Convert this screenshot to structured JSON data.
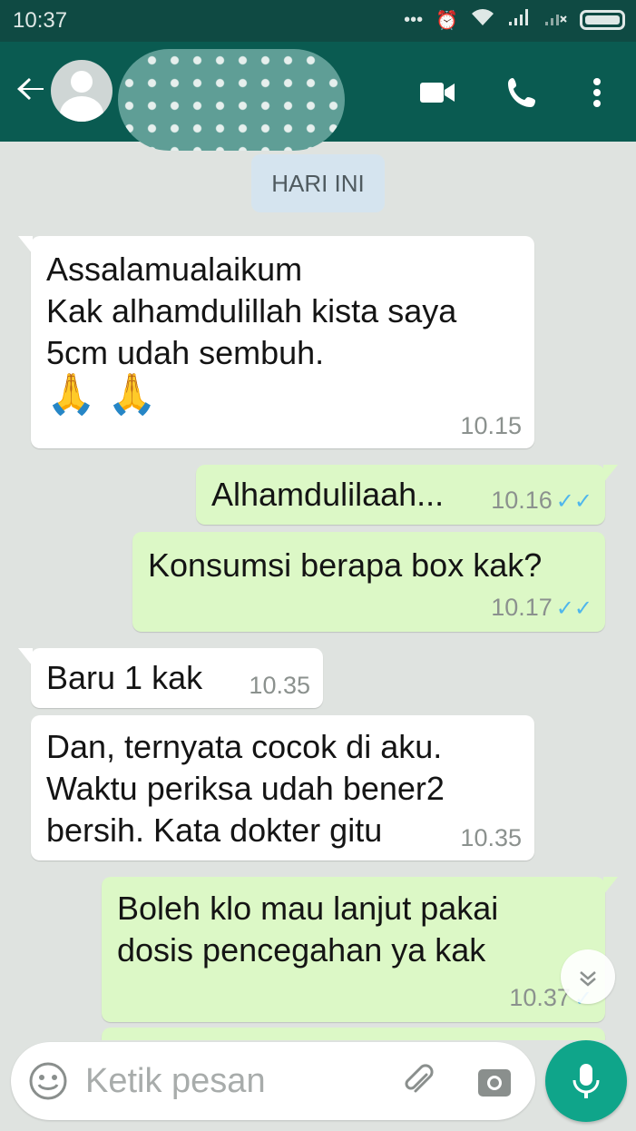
{
  "status_bar": {
    "time": "10:37",
    "icons": [
      "dots-icon",
      "alarm-icon",
      "wifi-icon",
      "signal-icon",
      "signal-nodata-icon",
      "battery-icon"
    ]
  },
  "header": {
    "contact_name": "",
    "icons": [
      "back-arrow-icon",
      "video-call-icon",
      "phone-icon",
      "more-vert-icon"
    ]
  },
  "chat": {
    "date_chip": "HARI INI",
    "messages": [
      {
        "direction": "incoming",
        "lines": [
          "Assalamualaikum",
          "Kak alhamdulillah kista saya",
          "5cm udah sembuh."
        ],
        "emoji": "🙏 🙏",
        "time": "10.15"
      },
      {
        "direction": "outgoing",
        "lines": [
          "Alhamdulilaah..."
        ],
        "time": "10.16",
        "ticks": "✓✓"
      },
      {
        "direction": "outgoing",
        "lines": [
          "Konsumsi berapa box kak?"
        ],
        "time": "10.17",
        "ticks": "✓✓"
      },
      {
        "direction": "incoming",
        "lines": [
          "Baru 1 kak"
        ],
        "time": "10.35"
      },
      {
        "direction": "incoming",
        "lines": [
          "Dan, ternyata cocok di aku.",
          "Waktu periksa udah bener2",
          "bersih. Kata dokter gitu"
        ],
        "time": "10.35"
      },
      {
        "direction": "outgoing",
        "lines": [
          "Boleh klo mau lanjut pakai",
          "dosis pencegahan ya kak"
        ],
        "time": "10.37",
        "ticks": "✓"
      }
    ]
  },
  "composer": {
    "placeholder": "Ketik pesan"
  },
  "colors": {
    "header": "#0a5b51",
    "status_bar": "#0f4a43",
    "outgoing_bubble": "#dcf8c6",
    "incoming_bubble": "#ffffff",
    "mic_button": "#0fa58a",
    "read_ticks": "#4fb6ec"
  }
}
